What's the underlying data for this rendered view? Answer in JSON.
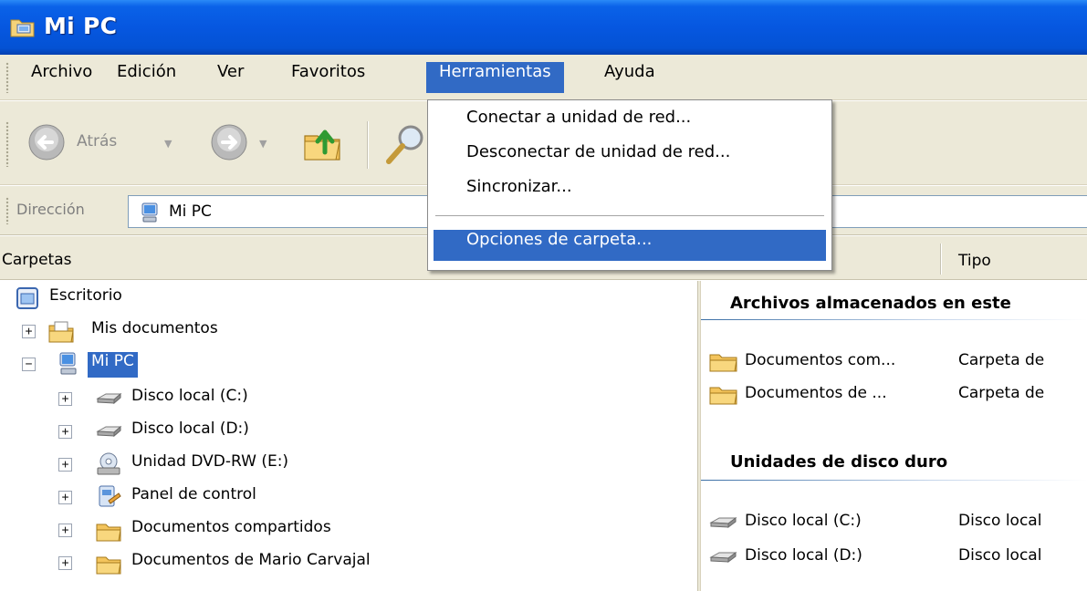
{
  "window": {
    "title": "Mi PC",
    "icon": "my-computer-folder-icon"
  },
  "menubar": {
    "items": [
      {
        "label": "Archivo"
      },
      {
        "label": "Edición"
      },
      {
        "label": "Ver"
      },
      {
        "label": "Favoritos"
      },
      {
        "label": "Herramientas",
        "active": true
      },
      {
        "label": "Ayuda"
      }
    ]
  },
  "toolbar": {
    "back_label": "Atrás",
    "back_icon": "back-arrow-icon",
    "forward_icon": "forward-arrow-icon",
    "up_icon": "up-folder-icon",
    "search_icon": "search-magnifier-icon"
  },
  "address": {
    "label": "Dirección",
    "value": "Mi PC",
    "icon": "computer-icon"
  },
  "folders_pane": {
    "header": "Carpetas"
  },
  "details": {
    "column_type": "Tipo"
  },
  "tree": {
    "desktop": "Escritorio",
    "my_documents": "Mis documentos",
    "my_pc": "Mi PC",
    "disk_c": "Disco local (C:)",
    "disk_d": "Disco local (D:)",
    "dvd": "Unidad DVD-RW (E:)",
    "control_panel": "Panel de control",
    "shared_docs": "Documentos compartidos",
    "user_docs": "Documentos de Mario Carvajal"
  },
  "right": {
    "group1_title": "Archivos almacenados en este",
    "group1_items": [
      {
        "name": "Documentos com...",
        "type": "Carpeta de"
      },
      {
        "name": "Documentos de ...",
        "type": "Carpeta de"
      }
    ],
    "group2_title": "Unidades de disco duro",
    "group2_items": [
      {
        "name": "Disco local (C:)",
        "type": "Disco local"
      },
      {
        "name": "Disco local (D:)",
        "type": "Disco local"
      }
    ]
  },
  "tools_menu": {
    "map_drive": "Conectar a unidad de red...",
    "disconnect_drive": "Desconectar de unidad de red...",
    "synchronize": "Sincronizar...",
    "folder_options": "Opciones de carpeta..."
  },
  "colors": {
    "titlebar": "#0657e0",
    "menu_highlight": "#316ac5",
    "chrome": "#ece9d8"
  }
}
